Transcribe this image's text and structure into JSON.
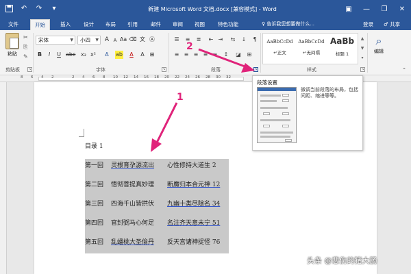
{
  "app": {
    "title": "新建 Microsoft Word 文档.docx [兼容模式] - Word",
    "qat_icons": [
      "save-icon",
      "undo-icon",
      "redo-icon",
      "customize-icon"
    ],
    "window_controls": [
      "ribbon-display-icon",
      "minimize-icon",
      "restore-icon",
      "close-icon"
    ]
  },
  "tabs": [
    {
      "label": "文件",
      "active": false
    },
    {
      "label": "开始",
      "active": true
    },
    {
      "label": "插入",
      "active": false
    },
    {
      "label": "设计",
      "active": false
    },
    {
      "label": "布局",
      "active": false
    },
    {
      "label": "引用",
      "active": false
    },
    {
      "label": "邮件",
      "active": false
    },
    {
      "label": "审阅",
      "active": false
    },
    {
      "label": "视图",
      "active": false
    },
    {
      "label": "特色功能",
      "active": false
    }
  ],
  "tell_me": "♀ 告诉我您想要做什么...",
  "login": "登录",
  "share": "♂ 共享",
  "ribbon": {
    "clipboard": {
      "paste": "粘贴",
      "label": "剪贴板"
    },
    "font": {
      "font_name": "宋体",
      "font_size": "小四",
      "label": "字体"
    },
    "paragraph": {
      "label": "段落"
    },
    "styles": {
      "label": "样式",
      "items": [
        {
          "sample": "AaBbCcDd",
          "name": "↵正文"
        },
        {
          "sample": "AaBbCcDd",
          "name": "↵无间隔"
        },
        {
          "sample": "AaBb",
          "name": "标题 1"
        }
      ]
    },
    "editing": {
      "label": "编辑"
    }
  },
  "ruler": {
    "numbers": [
      "8",
      "6",
      "4",
      "2",
      "",
      "2",
      "4",
      "6",
      "8",
      "10",
      "12",
      "14",
      "16",
      "18",
      "20",
      "22",
      "24",
      "26",
      "28",
      "30",
      "32"
    ]
  },
  "tooltip": {
    "title": "段落设置",
    "description": "微调当前段落的布局，包括间距、缩进等等。"
  },
  "document": {
    "toc_title": "目录 1",
    "entries": [
      {
        "chapter": "第一回",
        "a": "灵根育孕源流出",
        "b": "心性修持大道生 2"
      },
      {
        "chapter": "第二回",
        "a": "悟彻菩提真妙理",
        "b": "断魔归本合元神 12"
      },
      {
        "chapter": "第三回",
        "a": "四海千山皆拱伏",
        "b": "九幽十类尽除名 34"
      },
      {
        "chapter": "第四回",
        "a": "官封弼马心何足",
        "b": "名注齐天意未宁 51"
      },
      {
        "chapter": "第五回",
        "a": "乱蟠桃大圣偷丹",
        "b": "反天宫诸神捉怪 76"
      }
    ]
  },
  "annotations": {
    "num1": "1",
    "num2": "2",
    "arrow_color": "#e0237a"
  },
  "watermark": "头条 @悲伤的猪大肠",
  "colors": {
    "brand": "#2b579a",
    "ribbon_bg": "#f3f3f3",
    "selection": "#c9c9c9"
  }
}
